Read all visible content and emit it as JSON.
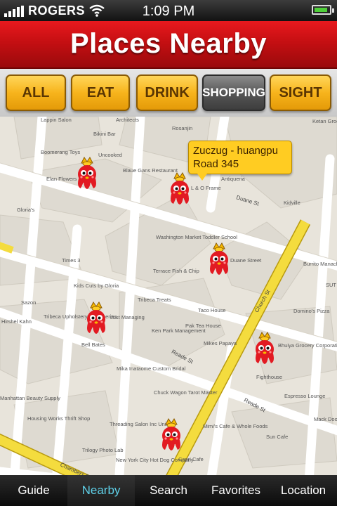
{
  "status": {
    "carrier": "ROGERS",
    "time": "1:09 PM",
    "battery_level": 0.9
  },
  "header": {
    "title": "Places Nearby"
  },
  "filters": [
    {
      "label": "ALL",
      "active": false
    },
    {
      "label": "EAT",
      "active": false
    },
    {
      "label": "DRINK",
      "active": false
    },
    {
      "label": "SHOPPING",
      "active": true
    },
    {
      "label": "SIGHT",
      "active": false
    }
  ],
  "callout": {
    "line1": "Zuczug - huangpu",
    "line2": "Road 345"
  },
  "map": {
    "places": [
      "Architects",
      "Rosanjin",
      "Ketan Grocery",
      "Lappin Salon",
      "Bikini Bar",
      "Boomerang Toys",
      "Uncooked",
      "Blaue Gans Restaurant",
      "Elan Flowers",
      "Antiqueria",
      "L & O Frame",
      "Kidville",
      "Gloria's",
      "Washington Market Toddler School",
      "Duane Street",
      "Times 3",
      "Burrito Manache",
      "SUT NE",
      "Kids Cuts by Gloria",
      "Terrace Fish & Chip",
      "Tribeca Treats",
      "Sazon",
      "Taco House",
      "Domino's Pizza",
      "Tribeca Upholstery & Draperies",
      "Just Managing",
      "Hirshel Kahn",
      "Pak Tea House",
      "Ken Park Management",
      "Mikes Papaya",
      "Bhuiya Grocery Corporation",
      "Bell Bates",
      "Mika Inataome Custom Bridal",
      "Fighthouse",
      "Chuck Wagon Tarot Master",
      "Espresso Lounge",
      "Manhattan Beauty Supply",
      "Housing Works Thrift Shop",
      "Threading Salon Inc Unique",
      "Mimi's Cafe & Whole Foods",
      "Sun Cafe",
      "Mack Door Co",
      "Trilogy Photo Lab",
      "New York City Hot Dog Company",
      "Capri Cafe"
    ],
    "streets": [
      "Duane St",
      "Church St",
      "Reade St",
      "Reade St",
      "Chambers St"
    ]
  },
  "tabs": [
    {
      "label": "Guide",
      "active": false
    },
    {
      "label": "Nearby",
      "active": true
    },
    {
      "label": "Search",
      "active": false
    },
    {
      "label": "Favorites",
      "active": false
    },
    {
      "label": "Location",
      "active": false
    }
  ],
  "colors": {
    "header_red": "#c50f12",
    "button_yellow": "#f7b41c",
    "active_tab_text": "#5fd0e8",
    "callout_yellow": "#ffcc22"
  },
  "icons": [
    "signal-icon",
    "wifi-icon",
    "battery-icon",
    "mascot-pin-icon"
  ]
}
